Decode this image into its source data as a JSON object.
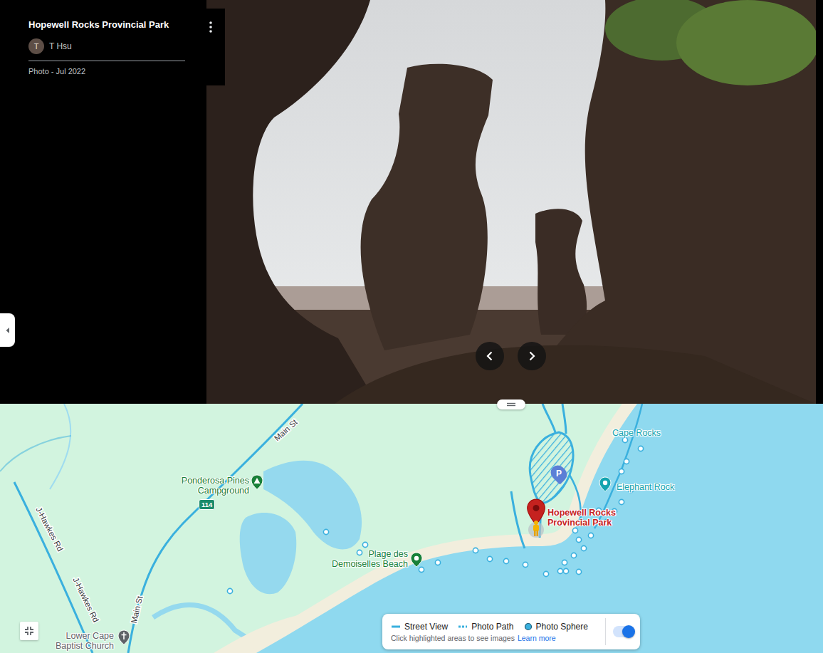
{
  "photo": {
    "title": "Hopewell Rocks Provincial Park",
    "author_initial": "T",
    "author": "T Hsu",
    "caption": "Photo - Jul 2022"
  },
  "map": {
    "roads": [
      {
        "text": "Main St"
      },
      {
        "text": "Main St"
      },
      {
        "text": "J-Hawkes Rd"
      },
      {
        "text": "J-Hawkes Rd"
      }
    ],
    "route_shield": "114",
    "parking": "P",
    "places": [
      {
        "lines": [
          "Ponderosa Pines",
          "Campground"
        ],
        "kind": "campground",
        "color": "#188038",
        "selected": false
      },
      {
        "lines": [
          "Plage des",
          "Demoiselles Beach"
        ],
        "kind": "beach",
        "color": "#188038",
        "selected": false
      },
      {
        "lines": [
          "Cape Rocks"
        ],
        "kind": "text",
        "color": "#12a4af",
        "selected": false
      },
      {
        "lines": [
          "Elephant Rock"
        ],
        "kind": "attraction",
        "color": "#12a4af",
        "selected": false
      },
      {
        "lines": [
          "Hopewell Rocks",
          "Provincial Park"
        ],
        "kind": "park",
        "color": "#c5221f",
        "selected": true
      },
      {
        "lines": [
          "Lower Cape",
          "Baptist Church"
        ],
        "kind": "church",
        "color": "#5f6368",
        "selected": false
      }
    ]
  },
  "legend": {
    "items": [
      {
        "label": "Street View",
        "kind": "line"
      },
      {
        "label": "Photo Path",
        "kind": "dashed"
      },
      {
        "label": "Photo Sphere",
        "kind": "dot"
      }
    ],
    "hint": "Click highlighted areas to see images",
    "link": "Learn more",
    "toggle": {
      "on": true
    }
  }
}
